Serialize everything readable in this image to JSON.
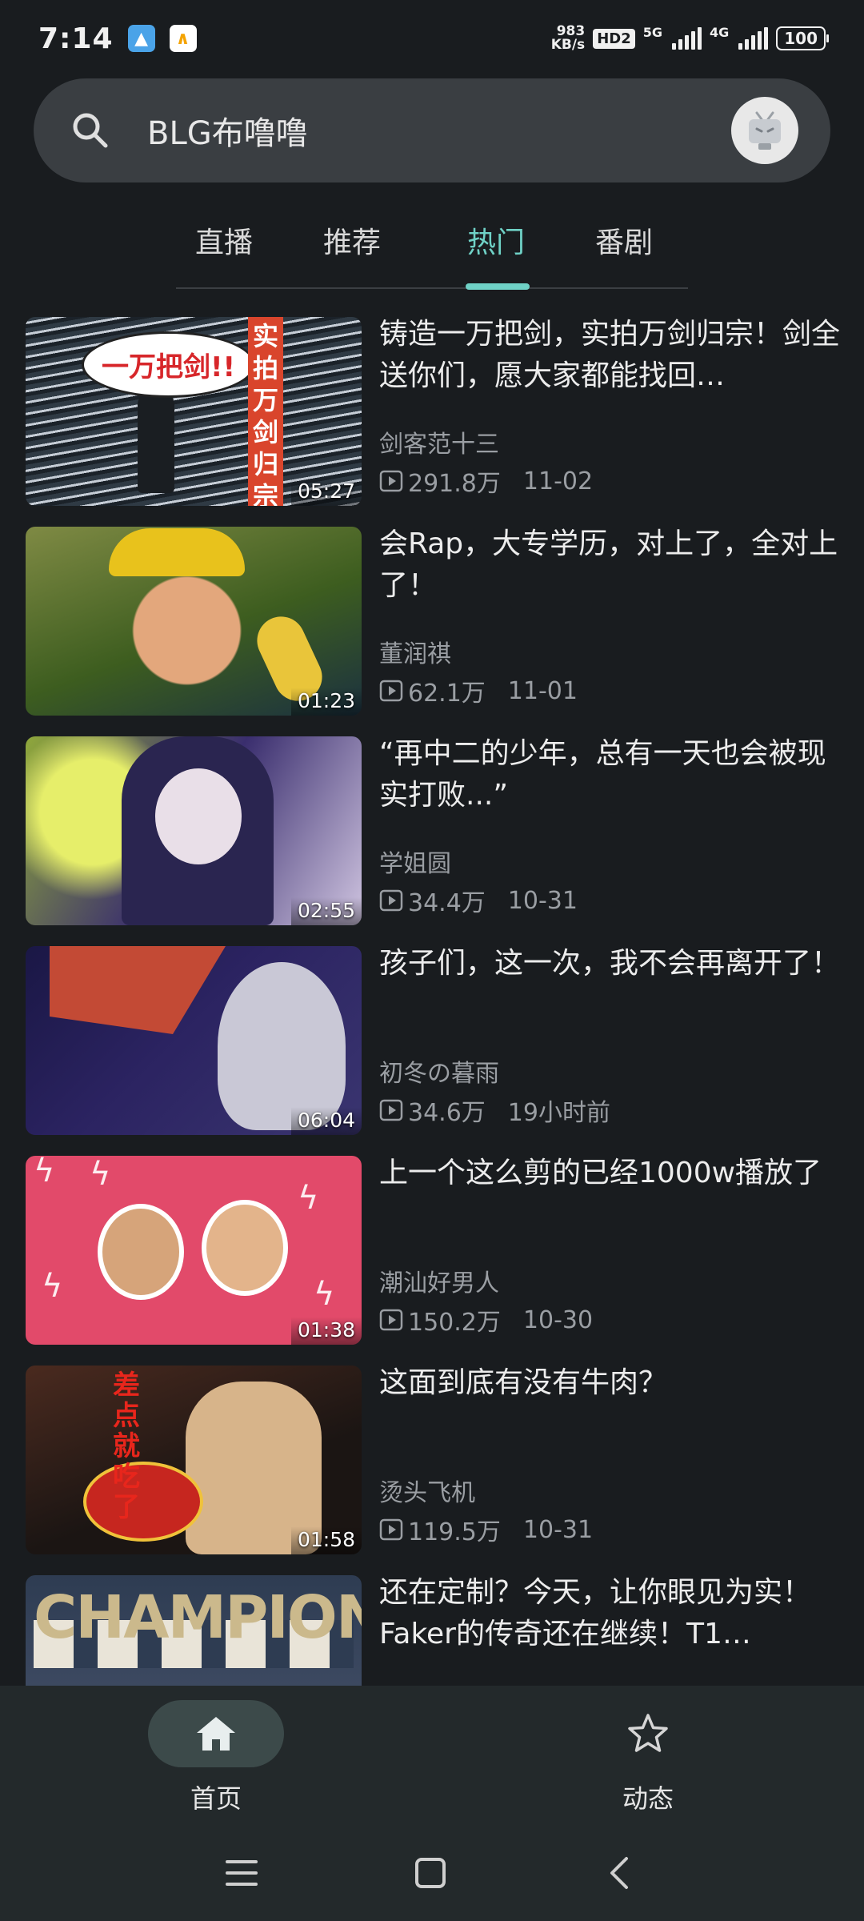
{
  "status_bar": {
    "time": "7:14",
    "net_speed_value": "983",
    "net_speed_unit": "KB/s",
    "hd_badge": "HD2",
    "signal1_label": "5G",
    "signal2_label": "4G",
    "battery": "100"
  },
  "search": {
    "query": "BLG布噜噜",
    "icon": "search-icon"
  },
  "tabs": [
    {
      "label": "直播",
      "active": false
    },
    {
      "label": "推荐",
      "active": false
    },
    {
      "label": "热门",
      "active": true
    },
    {
      "label": "番剧",
      "active": false
    }
  ],
  "videos": [
    {
      "title": "铸造一万把剑，实拍万剑归宗！剑全送你们，愿大家都能找回…",
      "author": "剑客范十三",
      "views": "291.8万",
      "date": "11-02",
      "duration": "05:27",
      "thumb_text_bubble": "一万把剑!!",
      "thumb_text_vertical": "实拍万剑归宗"
    },
    {
      "title": "会Rap，大专学历，对上了，全对上了！",
      "author": "董润祺",
      "views": "62.1万",
      "date": "11-01",
      "duration": "01:23"
    },
    {
      "title": "“再中二的少年，总有一天也会被现实打败...”",
      "author": "学姐圆",
      "views": "34.4万",
      "date": "10-31",
      "duration": "02:55"
    },
    {
      "title": "孩子们，这一次，我不会再离开了！",
      "author": "初冬の暮雨",
      "views": "34.6万",
      "date": "19小时前",
      "duration": "06:04"
    },
    {
      "title": "上一个这么剪的已经1000w播放了",
      "author": "潮汕好男人",
      "views": "150.2万",
      "date": "10-30",
      "duration": "01:38"
    },
    {
      "title": "这面到底有没有牛肉？",
      "author": "烫头飞机",
      "views": "119.5万",
      "date": "10-31",
      "duration": "01:58",
      "thumb_text": "差点就吃了"
    },
    {
      "title": "还在定制？今天，让你眼见为实！Faker的传奇还在继续！T1…",
      "author": "",
      "views": "",
      "date": "",
      "duration": "",
      "thumb_text": "CHAMPION"
    }
  ],
  "bottom_nav": {
    "home_label": "首页",
    "dynamic_label": "动态"
  },
  "colors": {
    "background": "#191c1f",
    "accent": "#6fd1c6",
    "nav_bg": "#23292b"
  }
}
